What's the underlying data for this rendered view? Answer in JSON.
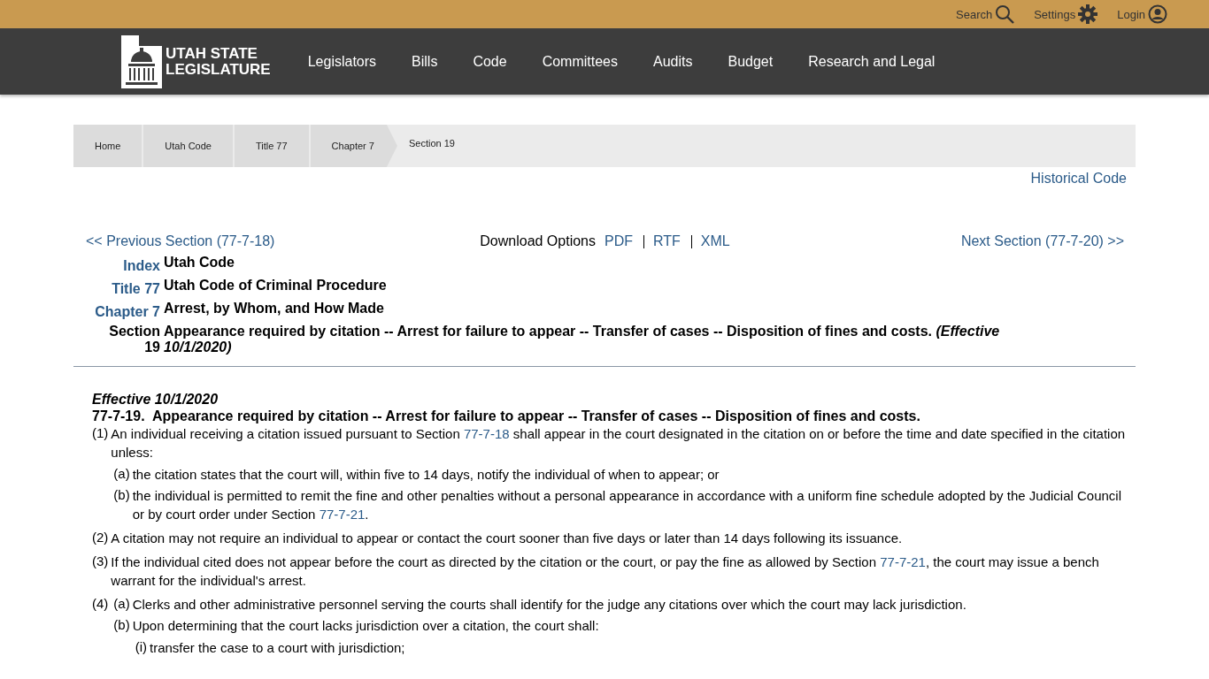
{
  "top_bar": {
    "links": [
      {
        "label": "Search",
        "kind": "search"
      },
      {
        "label": "Settings",
        "kind": "settings"
      },
      {
        "label": "Login",
        "kind": "login"
      }
    ]
  },
  "nav": {
    "logo": [
      "UTAH STATE",
      "LEGISLATURE"
    ],
    "items": [
      "Legislators",
      "Bills",
      "Code",
      "Committees",
      "Audits",
      "Budget",
      "Research and Legal"
    ]
  },
  "breadcrumbs": [
    {
      "label": "Home",
      "selected": false
    },
    {
      "label": "Utah Code",
      "selected": false
    },
    {
      "label": "Title 77",
      "selected": false
    },
    {
      "label": "Chapter 7",
      "selected": false
    },
    {
      "label": "Section 19",
      "selected": true
    }
  ],
  "historical_link": "Historical Code",
  "section_nav": {
    "previous": "<< Previous Section (77-7-18)",
    "download_label": "Download Options",
    "formats": [
      "PDF",
      "RTF",
      "XML"
    ],
    "next": "Next Section (77-7-20) >>"
  },
  "headings": [
    {
      "label": "Index",
      "value": "Utah Code"
    },
    {
      "label": "Title 77",
      "value": "Utah Code of Criminal Procedure"
    },
    {
      "label": "Chapter 7",
      "value": "Arrest, by Whom, and How Made"
    },
    {
      "label": "Section 19",
      "value": "Appearance required by citation -- Arrest for failure to appear -- Transfer of cases -- Disposition of fines and costs. *(Effective 10/1/2020)*"
    }
  ],
  "section": {
    "effective": "Effective 10/1/2020",
    "title": "77-7-19.  Appearance required by citation -- Arrest for failure to appear -- Transfer of cases -- Disposition of fines and costs.",
    "subsections": [
      {
        "num": "(1)",
        "parts": [
          {
            "text": "An individual receiving a citation issued pursuant to Section "
          },
          {
            "link": "77-7-18"
          },
          {
            "text": " shall appear in the court designated in the citation on or before the time and date specified in the citation unless:"
          }
        ],
        "children": [
          {
            "num": "(a)",
            "parts": [
              {
                "text": "the citation states that the court will, within five to 14 days, notify the individual of when to appear; or"
              }
            ]
          },
          {
            "num": "(b)",
            "parts": [
              {
                "text": "the individual is permitted to remit the fine and other penalties without a personal appearance in accordance with a uniform fine schedule adopted by the Judicial Council or by court order under Section "
              },
              {
                "link": "77-7-21"
              },
              {
                "text": "."
              }
            ]
          }
        ]
      },
      {
        "num": "(2)",
        "parts": [
          {
            "text": "A citation may not require an individual to appear or contact the court sooner than five days or later than 14 days following its issuance."
          }
        ]
      },
      {
        "num": "(3)",
        "parts": [
          {
            "text": "If the individual cited does not appear before the court as directed by the citation or the court, or pay the fine as allowed by Section "
          },
          {
            "link": "77-7-21"
          },
          {
            "text": ", the court may issue a bench warrant for the individual's arrest."
          }
        ]
      },
      {
        "num": "(4)",
        "children": [
          {
            "num": "(a)",
            "parts": [
              {
                "text": "Clerks and other administrative personnel serving the courts shall identify for the judge any citations over which the court may lack jurisdiction."
              }
            ]
          },
          {
            "num": "(b)",
            "parts": [
              {
                "text": "Upon determining that the court lacks jurisdiction over a citation, the court shall:"
              }
            ],
            "children": [
              {
                "num": "(i)",
                "parts": [
                  {
                    "text": "transfer the case to a court with jurisdiction;"
                  }
                ]
              }
            ]
          }
        ]
      }
    ]
  }
}
